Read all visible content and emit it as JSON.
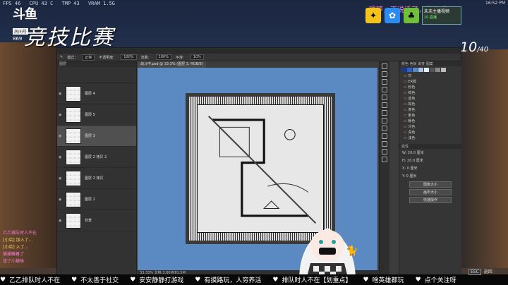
{
  "hud": {
    "fps": "FPS 46",
    "cpu": "CPU 43 C",
    "temp": "TMP 43",
    "ram": "VRAM 1.5G"
  },
  "logo": {
    "mark": "斗鱼",
    "room": "房间号",
    "number": "869"
  },
  "overlay_title": "竞技比赛",
  "counter": {
    "current": "10",
    "total": "/40"
  },
  "top_right_text": "嗯哼，不说话了，见谅哦。",
  "notice": {
    "line1": "未未主播视频",
    "line2": "10·直播"
  },
  "clock": "16:52 PM",
  "photoshop": {
    "options_bar": [
      "模式：",
      "正常",
      "不透明度：",
      "100%",
      "流量：",
      "100%",
      "平滑：",
      "10%"
    ],
    "doc_tab": "战斗中.psd @ 33.3% (图层 3, RGB/8)",
    "status": "33.33%  文档:3.00M/81.5M",
    "layers_header": "图层",
    "layers": [
      {
        "name": "图层 4"
      },
      {
        "name": "图层 5"
      },
      {
        "name": "图层 3",
        "selected": true
      },
      {
        "name": "图层 2 拷贝 2"
      },
      {
        "name": "图层 2 拷贝"
      },
      {
        "name": "图层 2"
      },
      {
        "name": "背景"
      }
    ],
    "right_tabs": "颜色  色板  渐变  图案",
    "folders": [
      "灰",
      "ER版",
      "粉色",
      "棕色",
      "蓝色",
      "褐色",
      "黄色",
      "紫色",
      "暖色",
      "冷色",
      "深色",
      "浅色"
    ],
    "properties_header": "属性",
    "props": [
      "W: 20.0 厘米",
      "H: 20.0 厘米",
      "X: 0 厘米",
      "Y: 0 厘米"
    ],
    "buttons": [
      "图像大小",
      "画布大小",
      "快速操作"
    ],
    "swatch_colors": [
      "#1d3a8a",
      "#2a5fd0",
      "#5b8ac3",
      "#a9c6ea",
      "#e3edf8",
      "#555",
      "#888",
      "#bbb"
    ]
  },
  "chat": [
    "乙乙排队时人不在",
    "[小店] 加入了...",
    "[小店] 入了...",
    "猫猫睡着了",
    "送了小猫咪"
  ],
  "ticker": [
    "乙乙排队时人不在",
    "不太善于社交",
    "安安静静打游戏",
    "有摸路玩，人穷养活",
    "排队时人不在【划重点】",
    "啥英雄都玩",
    "点个关注呀"
  ],
  "esc": {
    "key": "ESC",
    "label": "返回"
  }
}
